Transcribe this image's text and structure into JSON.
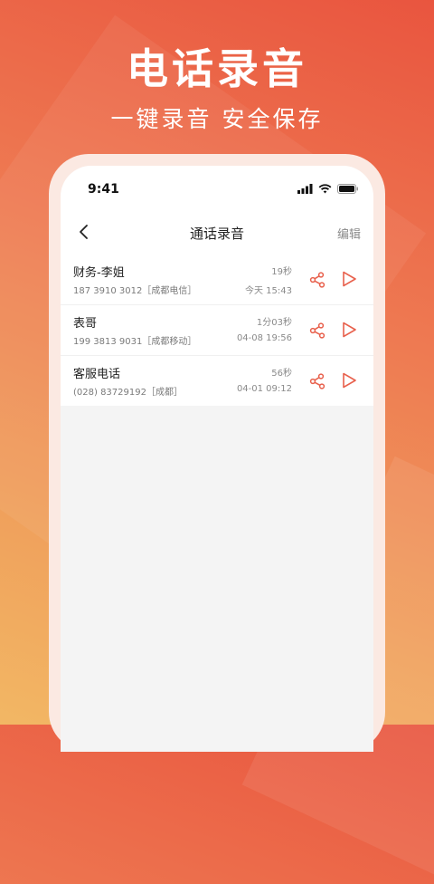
{
  "hero": {
    "title": "电话录音",
    "subtitle": "一键录音 安全保存"
  },
  "status_bar": {
    "time": "9:41",
    "icons": [
      "signal-icon",
      "wifi-icon",
      "battery-icon"
    ]
  },
  "nav": {
    "title": "通话录音",
    "edit_label": "编辑",
    "back_icon": "chevron-left-icon"
  },
  "recordings": [
    {
      "name": "财务-李姐",
      "detail": "187 3910 3012［成都电信］",
      "duration": "19秒",
      "date": "今天 15:43"
    },
    {
      "name": "表哥",
      "detail": "199 3813 9031［成都移动］",
      "duration": "1分03秒",
      "date": "04-08 19:56"
    },
    {
      "name": "客服电话",
      "detail": "(028) 83729192［成都］",
      "duration": "56秒",
      "date": "04-01 09:12"
    }
  ],
  "colors": {
    "accent": "#e8604c",
    "background_top": "#e9553f",
    "background_bottom": "#f2b764"
  }
}
